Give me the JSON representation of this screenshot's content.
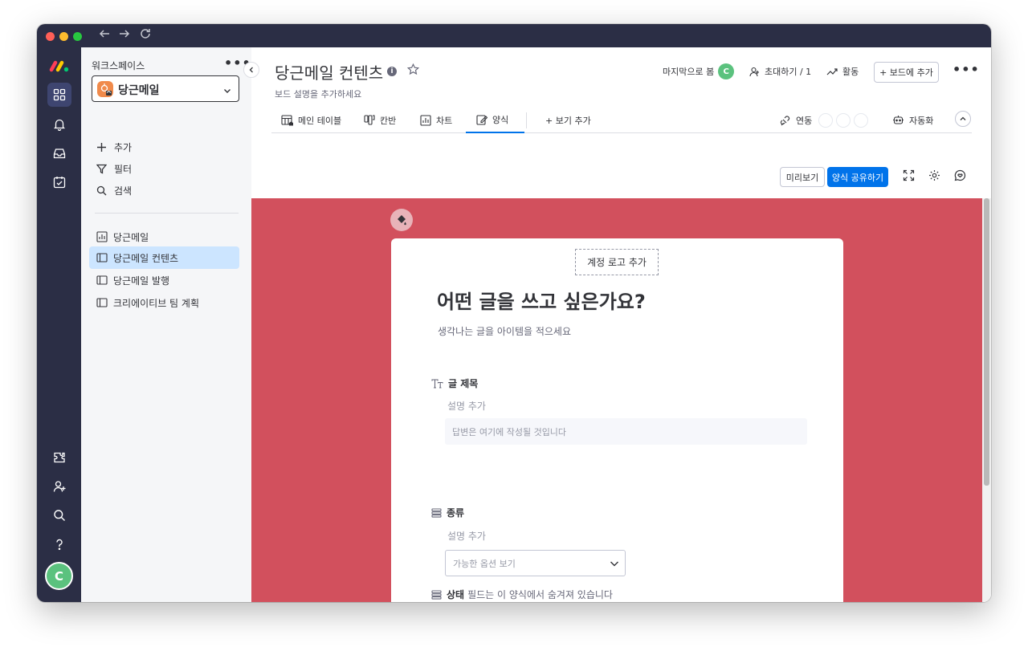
{
  "sidebar": {
    "workspace_label": "워크스페이스",
    "workspace_name": "당근메일",
    "actions": [
      {
        "icon": "plus-icon",
        "label": "추가"
      },
      {
        "icon": "filter-icon",
        "label": "필터"
      },
      {
        "icon": "search-icon",
        "label": "검색"
      }
    ],
    "boards": [
      {
        "icon": "chart-icon",
        "label": "당근메일"
      },
      {
        "icon": "board-icon",
        "label": "당근메일 컨텐츠",
        "active": true
      },
      {
        "icon": "board-icon",
        "label": "당근메일 발행"
      },
      {
        "icon": "board-icon",
        "label": "크리에이티브 팀 계획"
      }
    ]
  },
  "rail": {
    "avatar_initial": "C"
  },
  "header": {
    "board_title": "당근메일 컨텐츠",
    "board_description": "보드 설명을 추가하세요",
    "last_seen_label": "마지막으로 봄",
    "last_seen_avatar": "C",
    "invite_label": "초대하기 / 1",
    "activity_label": "활동",
    "add_to_board_label": "+ 보드에 추가"
  },
  "tabs": {
    "items": [
      {
        "icon": "table-icon",
        "label": "메인 테이블"
      },
      {
        "icon": "kanban-icon",
        "label": "칸반"
      },
      {
        "icon": "chart-icon",
        "label": "차트"
      },
      {
        "icon": "form-icon",
        "label": "양식",
        "active": true
      }
    ],
    "add_view_label": "+ 보기 추가",
    "integrate_label": "연동",
    "automate_label": "자동화"
  },
  "form_toolbar": {
    "preview_label": "미리보기",
    "share_label": "양식 공유하기"
  },
  "form": {
    "add_logo_label": "계정 로고 추가",
    "title": "어떤 글을 쓰고 싶은가요?",
    "subtitle": "생각나는 글을 아이템을 적으세요",
    "questions": [
      {
        "label": "글 제목",
        "description": "설명 추가",
        "answer_placeholder": "답변은 여기에 작성될 것입니다"
      },
      {
        "label": "종류",
        "description": "설명 추가",
        "select_placeholder": "가능한 옵션 보기"
      }
    ],
    "hidden_field_name": "상태",
    "hidden_field_note": "필드는 이 양식에서 숨겨져 있습니다"
  },
  "colors": {
    "form_background": "#d2505d",
    "primary": "#0073ea",
    "rail": "#2b2e45"
  }
}
